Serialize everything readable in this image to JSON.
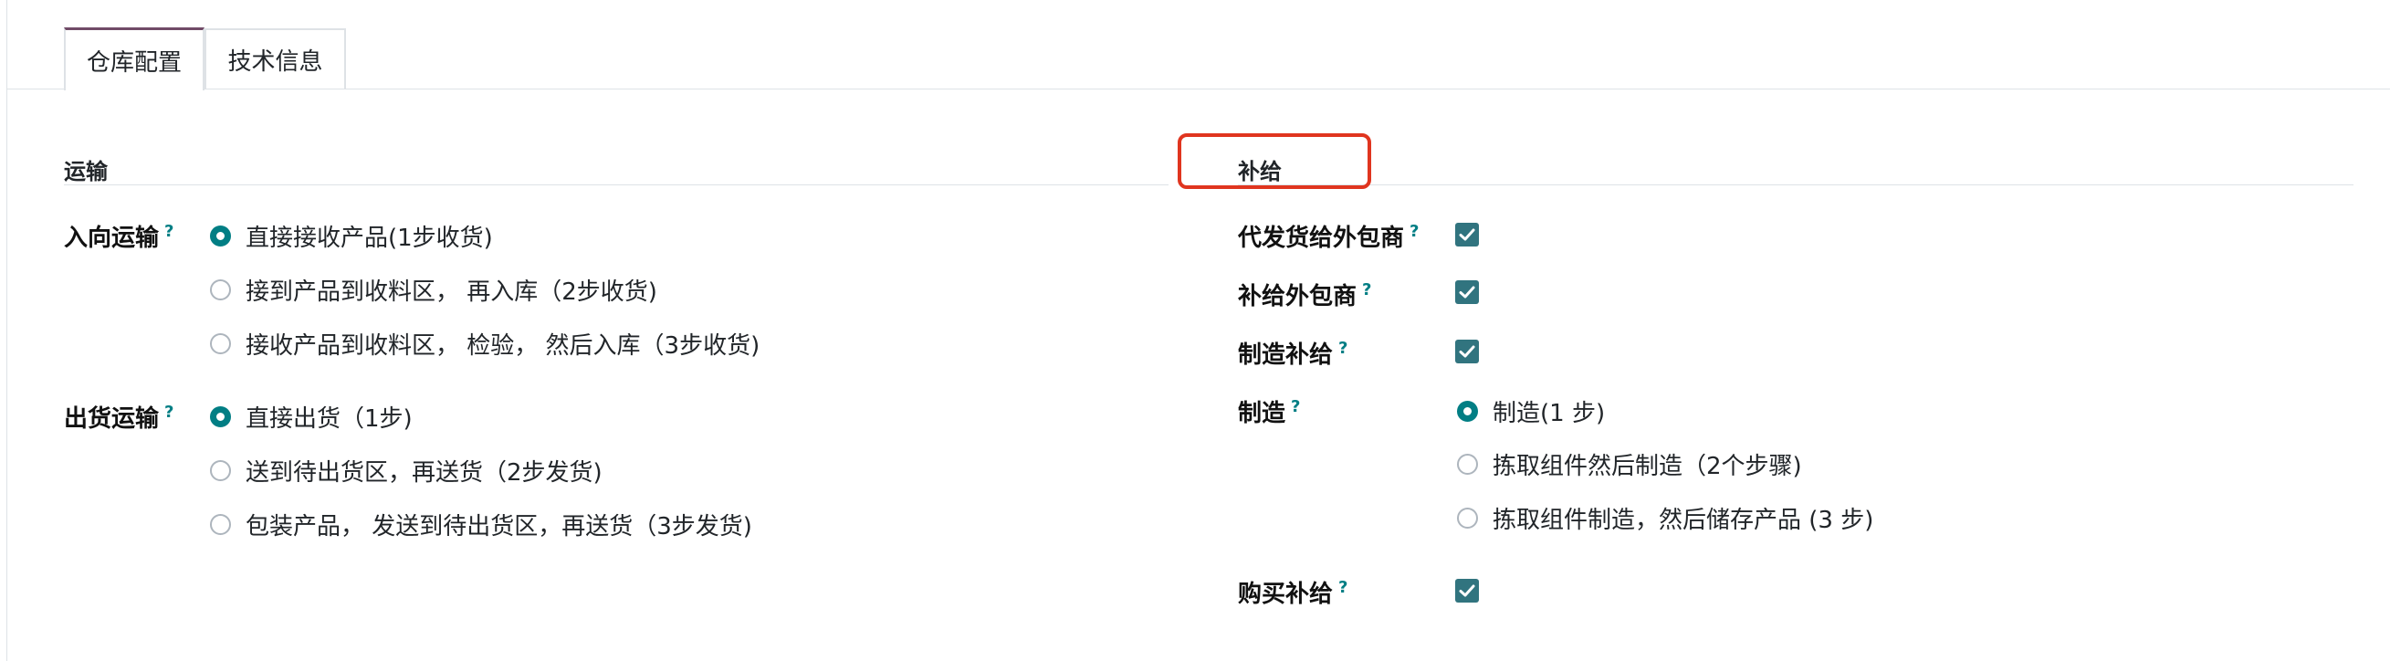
{
  "tabs": [
    {
      "label": "仓库配置",
      "active": true
    },
    {
      "label": "技术信息",
      "active": false
    }
  ],
  "shipping": {
    "title": "运输",
    "incoming": {
      "label": "入向运输",
      "help": "?",
      "options": [
        {
          "label": "直接接收产品(1步收货)",
          "checked": true
        },
        {
          "label": "接到产品到收料区， 再入库（2步收货)",
          "checked": false
        },
        {
          "label": "接收产品到收料区， 检验， 然后入库（3步收货)",
          "checked": false
        }
      ]
    },
    "outgoing": {
      "label": "出货运输",
      "help": "?",
      "options": [
        {
          "label": "直接出货（1步)",
          "checked": true
        },
        {
          "label": "送到待出货区，再送货（2步发货)",
          "checked": false
        },
        {
          "label": "包装产品， 发送到待出货区，再送货（3步发货)",
          "checked": false
        }
      ]
    }
  },
  "resupply": {
    "title": "补给",
    "dropship_subcontractor": {
      "label": "代发货给外包商",
      "help": "?",
      "checked": true
    },
    "resupply_subcontractor": {
      "label": "补给外包商",
      "help": "?",
      "checked": true
    },
    "manufacture_resupply": {
      "label": "制造补给",
      "help": "?",
      "checked": true
    },
    "manufacture": {
      "label": "制造",
      "help": "?",
      "options": [
        {
          "label": "制造(1 步)",
          "checked": true
        },
        {
          "label": "拣取组件然后制造（2个步骤)",
          "checked": false
        },
        {
          "label": "拣取组件制造，然后储存产品 (3 步)",
          "checked": false
        }
      ]
    },
    "buy_resupply": {
      "label": "购买补给",
      "help": "?",
      "checked": true
    }
  },
  "colors": {
    "accent": "#017e84",
    "checkbox": "#31747f",
    "tab_active": "#714b67",
    "highlight": "#e0351f"
  }
}
